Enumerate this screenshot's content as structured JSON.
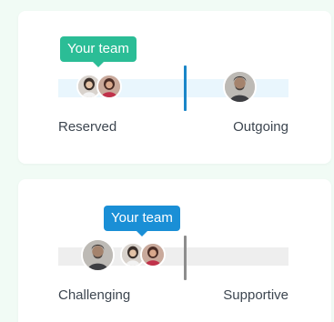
{
  "colors": {
    "page_background": "#f1fbf5",
    "card_background": "#ffffff",
    "tooltip_green": "#2bbd96",
    "tooltip_blue": "#1a8fd6",
    "marker_blue": "#1a86c8",
    "marker_gray": "#8d8d8d",
    "track_light_blue": "#e9f6fd",
    "track_gray": "#eeeeee",
    "label_text": "#3d4650"
  },
  "scales": [
    {
      "tooltip": "Your team",
      "left_label": "Reserved",
      "right_label": "Outgoing",
      "avatars": [
        "woman-avatar",
        "woman-red-avatar",
        "man-avatar"
      ]
    },
    {
      "tooltip": "Your team",
      "left_label": "Challenging",
      "right_label": "Supportive",
      "avatars": [
        "man-avatar",
        "woman-avatar",
        "woman-red-avatar"
      ]
    }
  ]
}
